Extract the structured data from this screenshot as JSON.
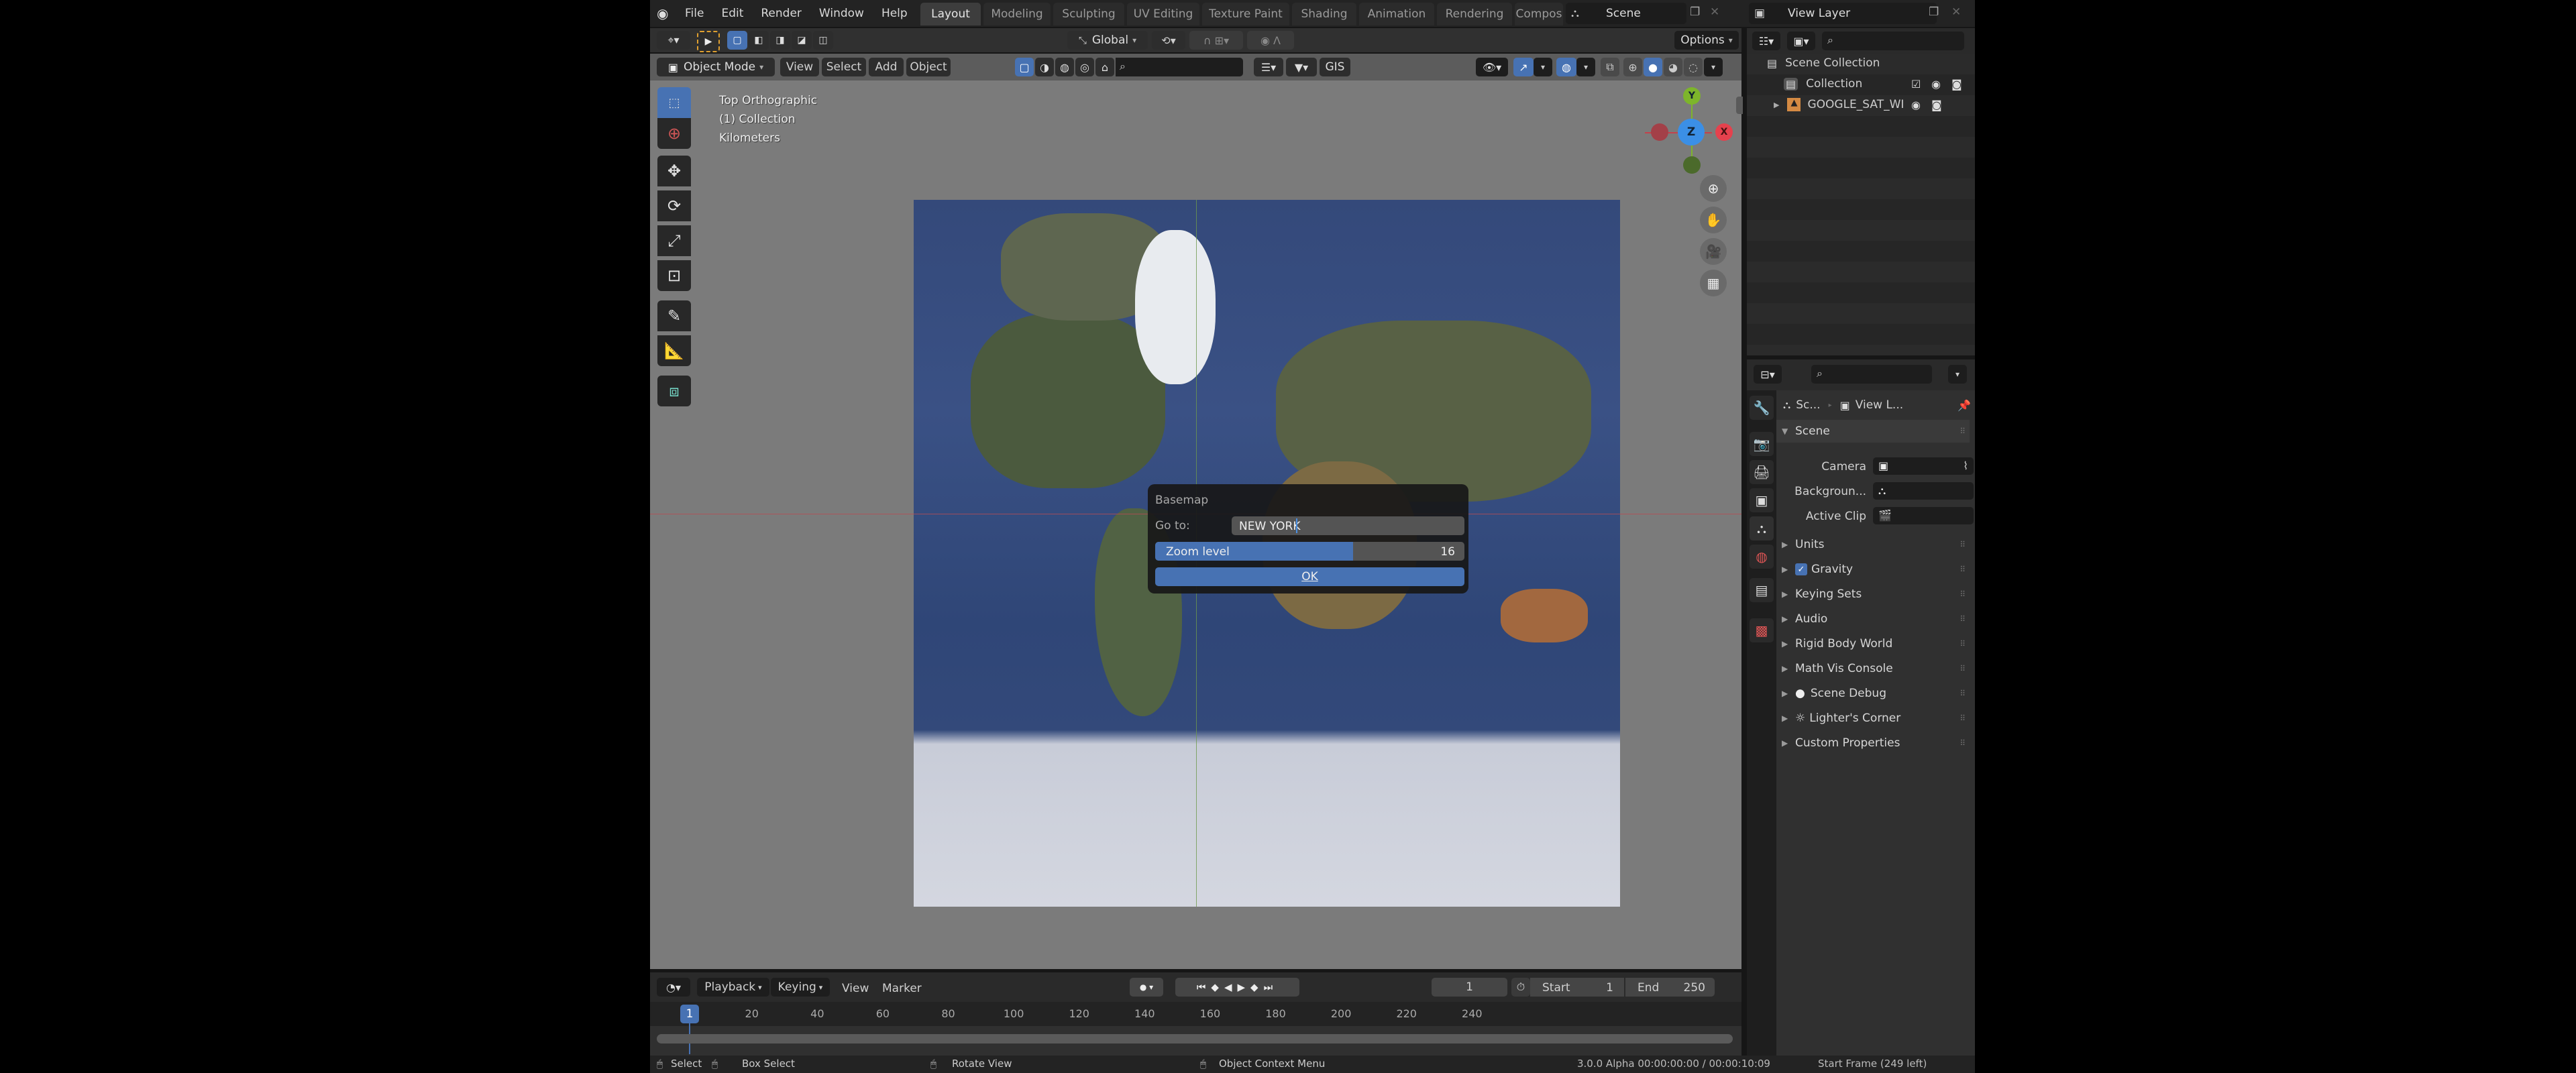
{
  "topbar": {
    "menu": [
      "File",
      "Edit",
      "Render",
      "Window",
      "Help"
    ],
    "workspaces": [
      "Layout",
      "Modeling",
      "Sculpting",
      "UV Editing",
      "Texture Paint",
      "Shading",
      "Animation",
      "Rendering",
      "Compos"
    ],
    "active_workspace": "Layout",
    "scene_name": "Scene",
    "view_layer_name": "View Layer"
  },
  "viewport": {
    "transform_orientation": "Global",
    "options_label": "Options",
    "mode": "Object Mode",
    "menus": [
      "View",
      "Select",
      "Add",
      "Object"
    ],
    "gis_label": "GIS",
    "overlay_lines": [
      "Top Orthographic",
      "(1) Collection",
      "Kilometers"
    ],
    "gizmo": {
      "y": "Y",
      "z": "Z",
      "x": "X"
    }
  },
  "dialog": {
    "title": "Basemap",
    "goto_label": "Go to:",
    "goto_value": "NEW YORK",
    "zoom_label": "Zoom level",
    "zoom_value": "16",
    "zoom_fill_fraction": 0.64,
    "ok_label": "OK"
  },
  "timeline": {
    "menus": [
      "Playback",
      "Keying",
      "View",
      "Marker"
    ],
    "current_frame": "1",
    "start_label": "Start",
    "start_value": "1",
    "end_label": "End",
    "end_value": "250",
    "ruler": [
      "20",
      "40",
      "60",
      "80",
      "100",
      "120",
      "140",
      "160",
      "180",
      "200",
      "220",
      "240"
    ],
    "playhead": "1"
  },
  "statusbar": {
    "select": "Select",
    "box_select": "Box Select",
    "rotate_view": "Rotate View",
    "context_menu": "Object Context Menu",
    "version_time": "3.0.0 Alpha  00:00:00:00 / 00:00:10:09",
    "frame_info": "Start Frame (249 left)"
  },
  "outliner": {
    "root": "Scene Collection",
    "items": [
      {
        "label": "Collection"
      },
      {
        "label": "GOOGLE_SAT_WI"
      }
    ]
  },
  "properties": {
    "breadcrumb_scene": "Sc...",
    "breadcrumb_layer": "View L...",
    "panel_title": "Scene",
    "fields": [
      {
        "label": "Camera"
      },
      {
        "label": "Backgroun..."
      },
      {
        "label": "Active Clip"
      }
    ],
    "panels": [
      "Units",
      "Gravity",
      "Keying Sets",
      "Audio",
      "Rigid Body World",
      "Math Vis Console",
      "Scene Debug",
      "Lighter's Corner",
      "Custom Properties"
    ],
    "gravity_checked": true
  },
  "colors": {
    "accent": "#4772b3",
    "x_axis": "#e5414d",
    "y_axis": "#7db52b",
    "z_axis": "#3b8fe6",
    "object_orange": "#d48a43"
  }
}
